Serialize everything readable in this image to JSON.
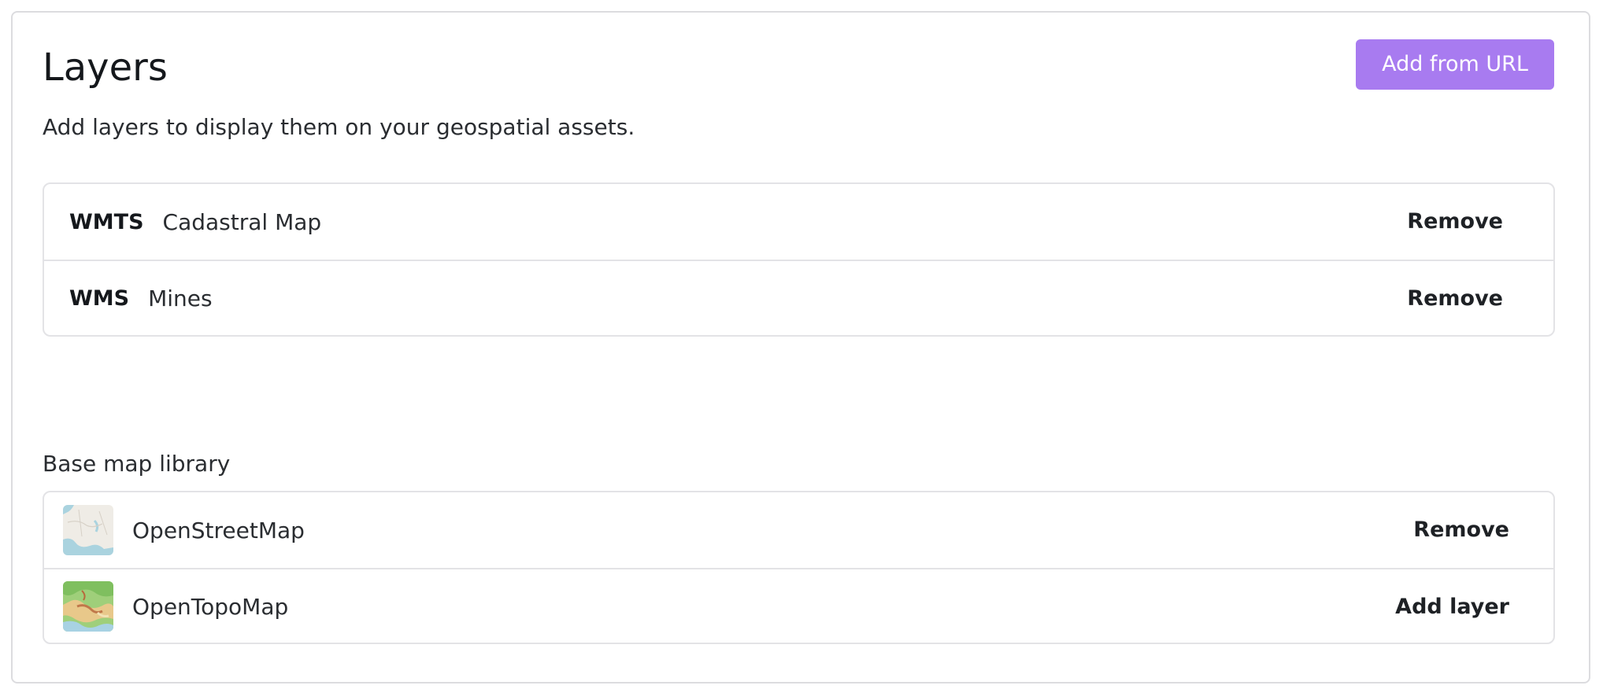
{
  "header": {
    "title": "Layers",
    "subtitle": "Add layers to display them on your geospatial assets.",
    "add_url_label": "Add from URL"
  },
  "layers": [
    {
      "type": "WMTS",
      "name": "Cadastral Map",
      "action": "Remove"
    },
    {
      "type": "WMS",
      "name": "Mines",
      "action": "Remove"
    }
  ],
  "basemaps": {
    "label": "Base map library",
    "items": [
      {
        "name": "OpenStreetMap",
        "action": "Remove",
        "thumbnail": "openstreetmap-thumbnail"
      },
      {
        "name": "OpenTopoMap",
        "action": "Add layer",
        "thumbnail": "opentopomap-thumbnail"
      }
    ]
  },
  "colors": {
    "accent": "#a87bf0",
    "border": "#e3e3e6",
    "text": "#15181c"
  }
}
